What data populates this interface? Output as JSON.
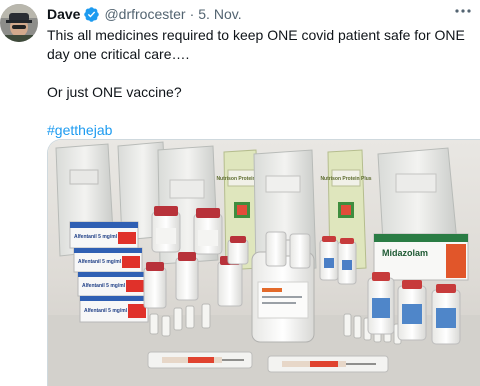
{
  "tweet": {
    "author_name": "Dave",
    "handle": "@drfrocester",
    "separator": "·",
    "date": "5. Nov.",
    "text_line1": "This all medicines required to keep ONE covid patient safe for ONE day one critical care….",
    "text_line2": "Or just ONE vaccine?",
    "hashtag": "#getthejab"
  },
  "media": {
    "box_labels": [
      "Alfentanil 5 mg/ml",
      "Alfentanil 5 mg/ml",
      "Alfentanil 5 mg/ml",
      "Alfentanil 5 mg/ml"
    ],
    "bag_labels": [
      "Nutrison Protein Plus",
      "Nutrison Protein Plus"
    ],
    "midazolam_label": "Midazolam"
  },
  "icons": {
    "verified": "verified-badge-icon",
    "more": "more-options-icon"
  },
  "colors": {
    "link": "#1d9bf0",
    "verified": "#1d9bf0",
    "secondary_text": "#536471"
  }
}
